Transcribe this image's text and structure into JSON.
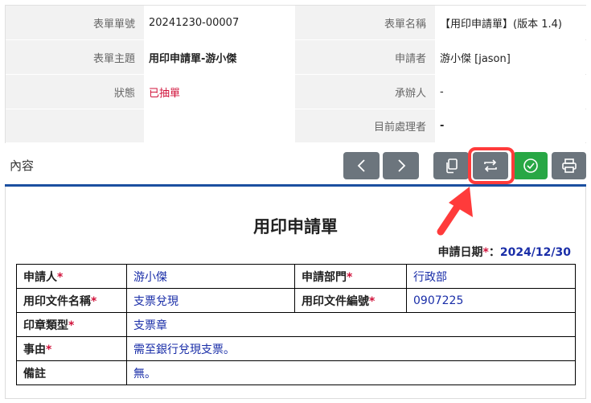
{
  "info": {
    "rows": [
      {
        "label1": "表單單號",
        "value1": "20241230-00007",
        "label2": "表單名稱",
        "value2": "【用印申請單】(版本 1.4)"
      },
      {
        "label1": "表單主題",
        "value1": "用印申請單-游小傑",
        "label2": "申請者",
        "value2": "游小傑 [jason]"
      },
      {
        "label1": "狀態",
        "value1": "已抽單",
        "label2": "承辦人",
        "value2": "-"
      },
      {
        "label1": "",
        "value1": "",
        "label2": "目前處理者",
        "value2": "-"
      }
    ]
  },
  "content_label": "內容",
  "toolbar": {
    "buttons": [
      {
        "icon": "chevron-left-icon"
      },
      {
        "icon": "chevron-right-icon"
      },
      {
        "icon": "copy-icon"
      },
      {
        "icon": "switch-arrows-icon"
      },
      {
        "icon": "check-circle-icon"
      },
      {
        "icon": "printer-icon"
      }
    ],
    "colors": {
      "gray": "#6c757d",
      "green": "#28a745",
      "highlight": "#ff3b3b"
    }
  },
  "document": {
    "title": "用印申請單",
    "apply_date_label": "申請日期",
    "apply_date_required": "*",
    "apply_date_colon": "：",
    "apply_date_value": "2024/12/30",
    "required_mark": "*",
    "fields": {
      "applicant_label": "申請人",
      "applicant_value": "游小傑",
      "dept_label": "申請部門",
      "dept_value": "行政部",
      "doc_name_label": "用印文件名稱",
      "doc_name_value": "支票兌現",
      "doc_no_label": "用印文件編號",
      "doc_no_value": "0907225",
      "seal_type_label": "印章類型",
      "seal_type_value": "支票章",
      "reason_label": "事由",
      "reason_value": "需至銀行兌現支票。",
      "remark_label": "備註",
      "remark_value": "無。"
    }
  }
}
